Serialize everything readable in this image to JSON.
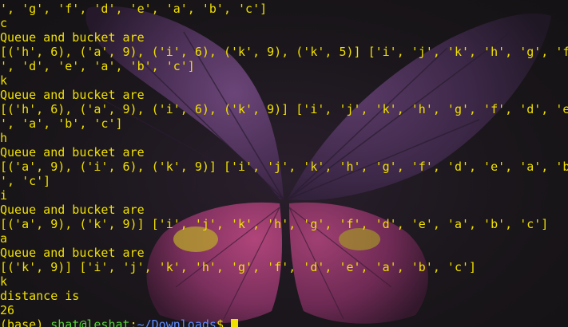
{
  "terminal": {
    "lines": [
      "', 'g', 'f', 'd', 'e', 'a', 'b', 'c']",
      "c",
      "Queue and bucket are",
      "[('h', 6), ('a', 9), ('i', 6), ('k', 9), ('k', 5)] ['i', 'j', 'k', 'h', 'g', 'f",
      "', 'd', 'e', 'a', 'b', 'c']",
      "k",
      "Queue and bucket are",
      "[('h', 6), ('a', 9), ('i', 6), ('k', 9)] ['i', 'j', 'k', 'h', 'g', 'f', 'd', 'e",
      "', 'a', 'b', 'c']",
      "h",
      "Queue and bucket are",
      "[('a', 9), ('i', 6), ('k', 9)] ['i', 'j', 'k', 'h', 'g', 'f', 'd', 'e', 'a', 'b",
      "', 'c']",
      "i",
      "Queue and bucket are",
      "[('a', 9), ('k', 9)] ['i', 'j', 'k', 'h', 'g', 'f', 'd', 'e', 'a', 'b', 'c']",
      "a",
      "Queue and bucket are",
      "[('k', 9)] ['i', 'j', 'k', 'h', 'g', 'f', 'd', 'e', 'a', 'b', 'c']",
      "k",
      "distance is",
      "26"
    ],
    "prompt": {
      "env": "(base) ",
      "user": "shat@leshat",
      "sep": ":",
      "path": "~/Downloads",
      "dollar": "$ "
    },
    "colors": {
      "output_text": "#f0e000",
      "prompt_user": "#57d636",
      "prompt_path": "#5f8cff",
      "background": "#171518"
    }
  }
}
